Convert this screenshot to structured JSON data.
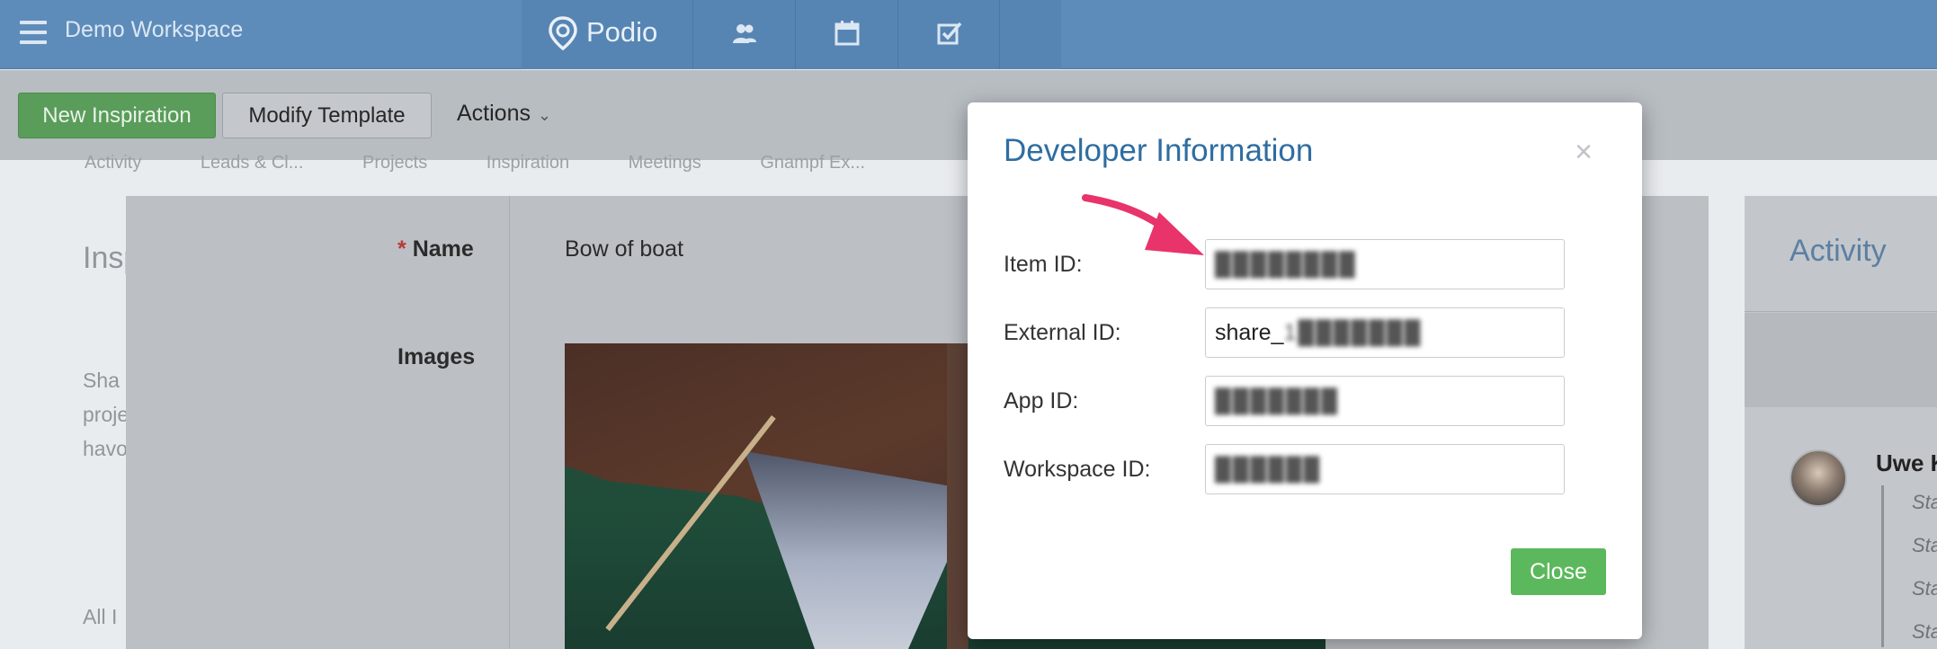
{
  "topbar": {
    "workspace_title": "Demo Workspace",
    "brand": "Podio",
    "nav_icons": [
      "contacts-icon",
      "calendar-icon",
      "tasks-icon"
    ]
  },
  "toolbar": {
    "new_label": "New Inspiration",
    "modify_label": "Modify Template",
    "actions_label": "Actions"
  },
  "background": {
    "tabs": [
      "Activity",
      "Leads & Cl...",
      "Projects",
      "Inspiration",
      "Meetings",
      "Gnampf Ex..."
    ],
    "left_heading": "Insp",
    "left_desc": [
      "Sha",
      "proje",
      "havo"
    ],
    "left_all": "All I",
    "fields": {
      "name_label": "Name",
      "name_required": "*",
      "name_value": "Bow of boat",
      "images_label": "Images"
    },
    "activity": {
      "title": "Activity",
      "user": "Uwe K",
      "statuses": [
        "Sta",
        "Sta",
        "Sta",
        "Sta"
      ]
    }
  },
  "modal": {
    "title": "Developer Information",
    "close_symbol": "×",
    "rows": [
      {
        "label": "Item ID:",
        "value": "████████",
        "blurred": true
      },
      {
        "label": "External ID:",
        "value_prefix": "share_",
        "value": "1███████",
        "blurred": true
      },
      {
        "label": "App ID:",
        "value": "███████",
        "blurred": true
      },
      {
        "label": "Workspace ID:",
        "value": "██████",
        "blurred": true
      }
    ],
    "close_button": "Close"
  },
  "colors": {
    "topbar": "#5d8cba",
    "primary_green": "#5cb85c",
    "modal_title": "#2f6da1",
    "arrow": "#e8336b"
  }
}
